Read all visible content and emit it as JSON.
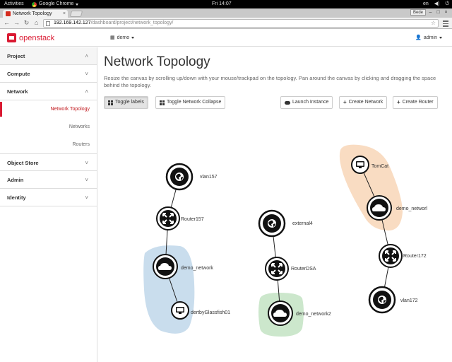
{
  "system": {
    "activities": "Activities",
    "app_name": "Google Chrome",
    "clock": "Fri 14:07",
    "lang": "en"
  },
  "browser": {
    "tab_title": "Network Topology",
    "tab_close": "×",
    "user_badge": "Bede",
    "url_host": "192.169.142.127",
    "url_path": "/dashboard/project/network_topology/"
  },
  "header": {
    "brand": "openstack",
    "project": "demo",
    "user": "admin"
  },
  "sidebar": {
    "project": "Project",
    "compute": "Compute",
    "network": "Network",
    "network_topology": "Network Topology",
    "networks": "Networks",
    "routers": "Routers",
    "object_store": "Object Store",
    "admin": "Admin",
    "identity": "Identity"
  },
  "main": {
    "title": "Network Topology",
    "help": "Resize the canvas by scrolling up/down with your mouse/trackpad on the topology. Pan around the canvas by clicking and dragging the space behind the topology.",
    "toggle_labels": "Toggle labels",
    "toggle_collapse": "Toggle Network Collapse",
    "launch_instance": "Launch Instance",
    "create_network": "Create Network",
    "create_router": "Create Router"
  },
  "topology": {
    "vlan157": "vlan157",
    "router157": "Router157",
    "demo_network": "demo_network",
    "dertby": "dertbyGlassfish01",
    "external4": "external4",
    "routerdsa": "RouterDSA",
    "demo_network2": "demo_network2",
    "tomcat": "TomCat",
    "demo_networl": "demo_networl",
    "router172": "Router172",
    "vlan172": "vlan172",
    "colors": {
      "blue_group": "#c9dded",
      "green_group": "#cce7cc",
      "orange_group": "#f9dcc2"
    }
  }
}
